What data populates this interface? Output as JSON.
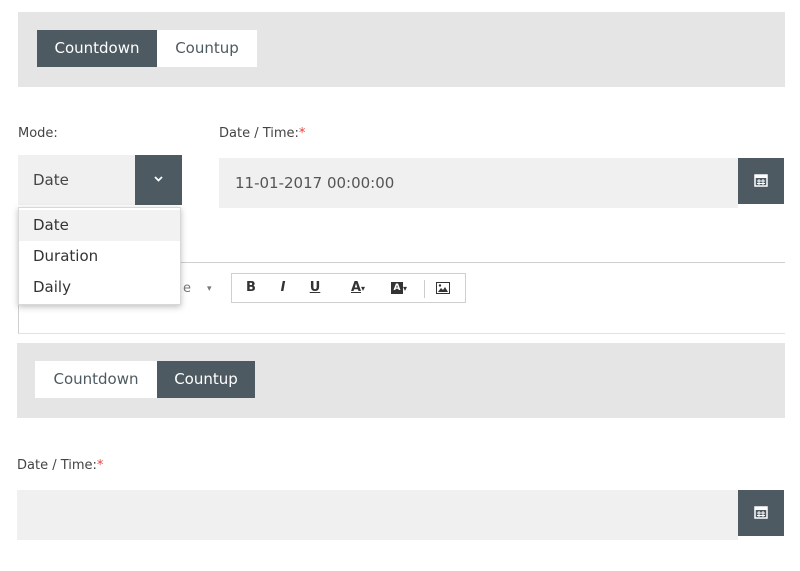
{
  "section1": {
    "tabs": [
      {
        "label": "Countdown",
        "active": true
      },
      {
        "label": "Countup",
        "active": false
      }
    ],
    "mode": {
      "label": "Mode:",
      "selected": "Date",
      "options": [
        "Date",
        "Duration",
        "Daily"
      ]
    },
    "datetime": {
      "label": "Date / Time:",
      "required_mark": "*",
      "value": "11-01-2017 00:00:00"
    },
    "editor": {
      "partial_text": "e",
      "buttons": [
        "B",
        "I",
        "U",
        "A",
        "A"
      ],
      "icons": [
        "dropdown-caret",
        "text-color",
        "background-color",
        "image"
      ]
    }
  },
  "section2": {
    "tabs": [
      {
        "label": "Countdown",
        "active": false
      },
      {
        "label": "Countup",
        "active": true
      }
    ],
    "datetime": {
      "label": "Date / Time:",
      "required_mark": "*",
      "value": ""
    }
  },
  "colors": {
    "accent_dark": "#4d5a61",
    "panel_grey": "#e5e5e5",
    "field_grey": "#f0f0f0",
    "required_red": "#e8413a"
  }
}
